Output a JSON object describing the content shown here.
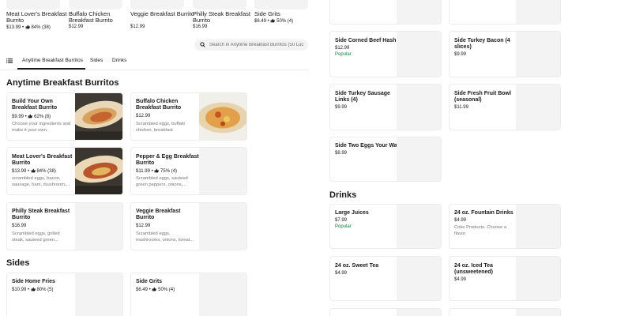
{
  "carousel": [
    {
      "name": "Meat Lover's Breakfast Burrito",
      "price": "$13.99",
      "rating": "84% (38)"
    },
    {
      "name": "Buffalo Chicken Breakfast Burrito",
      "price": "$12.99",
      "rating": ""
    },
    {
      "name": "Veggie Breakfast Burrito",
      "price": "$12.99",
      "rating": ""
    },
    {
      "name": "Philly Steak Breakfast Burrito",
      "price": "$16.99",
      "rating": ""
    },
    {
      "name": "Side Grits",
      "price": "$6.49",
      "rating": "50% (4)"
    }
  ],
  "search": {
    "placeholder": "Search in Anytime Breakfast Burritos (50 Luc"
  },
  "nav": {
    "tabs": [
      "Anytime Breakfast Burritos",
      "Sides",
      "Drinks"
    ]
  },
  "sections": {
    "burritos": "Anytime Breakfast Burritos",
    "sides": "Sides",
    "drinks": "Drinks"
  },
  "burritos": [
    {
      "name": "Build Your Own Breakfast Burrito",
      "price": "$9.99",
      "rating": "62% (8)",
      "desc": "Choose your ingredients and make it your own."
    },
    {
      "name": "Buffalo Chicken Breakfast Burrito",
      "price": "$12.99",
      "rating": "",
      "desc": "Scrambled eggs, buffalo chicken, breakfast potatoes..."
    },
    {
      "name": "Meat Lover's Breakfast Burrito",
      "price": "$13.99",
      "rating": "84% (38)",
      "desc": "scrambled eggs, bacon, sausage, ham, mushroom,..."
    },
    {
      "name": "Pepper & Egg Breakfast Burrito",
      "price": "$11.99",
      "rating": "75% (4)",
      "desc": "Scrambled eggs, sauteed green peppers, onions,..."
    },
    {
      "name": "Philly Steak Breakfast Burrito",
      "price": "$16.99",
      "rating": "",
      "desc": "Scrambled eggs, grilled steak, sauteed green..."
    },
    {
      "name": "Veggie Breakfast Burrito",
      "price": "$12.99",
      "rating": "",
      "desc": "Scrambled eggs, mushrooms, onions, tomat..."
    }
  ],
  "sides_left": [
    {
      "name": "Side Home Fries",
      "price": "$10.99",
      "rating": "80% (5)"
    },
    {
      "name": "Side Grits",
      "price": "$6.49",
      "rating": "50% (4)"
    }
  ],
  "sides_right": [
    {
      "name": "Side Corned Beef Hash",
      "price": "$12.99",
      "popular": "Popular"
    },
    {
      "name": "Side Turkey Bacon (4 slices)",
      "price": "$9.99",
      "popular": ""
    },
    {
      "name": "Side Turkey Sausage Links (4)",
      "price": "$9.99",
      "popular": ""
    },
    {
      "name": "Side Fresh Fruit Bowl (seasonal)",
      "price": "$11.99",
      "popular": ""
    },
    {
      "name": "Side Two Eggs Your Way",
      "price": "$8.99",
      "popular": ""
    }
  ],
  "drinks": [
    {
      "name": "Large Juices",
      "price": "$7.99",
      "popular": "Popular",
      "desc": ""
    },
    {
      "name": "24 oz. Fountain Drinks",
      "price": "$4.99",
      "popular": "",
      "desc": "Coke Products. Choose a flavor."
    },
    {
      "name": "24 oz. Sweet Tea",
      "price": "$4.99",
      "popular": "",
      "desc": ""
    },
    {
      "name": "24 oz. Iced Tea (unsweetened)",
      "price": "$4.99",
      "popular": "",
      "desc": ""
    }
  ],
  "icons": {
    "thumb": "thumbs-up-icon",
    "search": "search-icon",
    "menu": "list-menu-icon"
  },
  "colors": {
    "popular": "#0e8345",
    "text": "#191919",
    "muted": "#757575",
    "placeholder": "#f3f3f3"
  }
}
